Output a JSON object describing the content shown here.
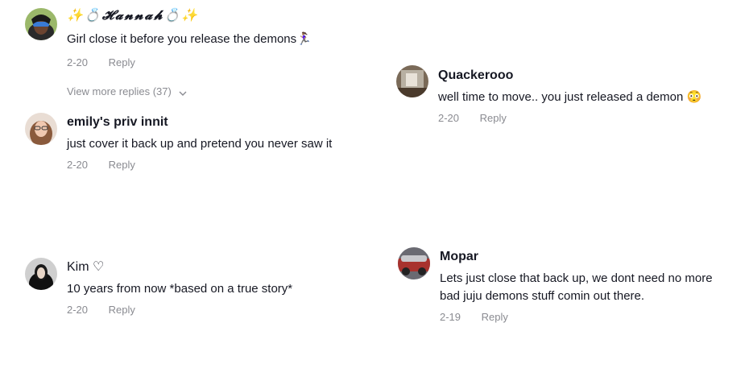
{
  "comments": [
    {
      "username": "✨💍𝓗𝓪𝓷𝓷𝓪𝓱💍✨",
      "text": "Girl close it before you release the demons🏃🏽‍♀️",
      "date": "2-20",
      "reply_label": "Reply",
      "avatar_icon": "user-avatar"
    },
    {
      "username": "emily's priv innit",
      "text": "just cover it back up and pretend you never saw it",
      "date": "2-20",
      "reply_label": "Reply",
      "avatar_icon": "user-avatar"
    },
    {
      "username": "Kim ♡",
      "text": "10 years from now *based on a true story*",
      "date": "2-20",
      "reply_label": "Reply",
      "avatar_icon": "user-avatar"
    },
    {
      "username": "Quackerooo",
      "text": "well time to move.. you just released a demon 😳",
      "date": "2-20",
      "reply_label": "Reply",
      "avatar_icon": "user-avatar"
    },
    {
      "username": "Mopar",
      "text_lines": [
        "Lets just close that back up, we dont need no more",
        "bad juju demons stuff comin out there."
      ],
      "date": "2-19",
      "reply_label": "Reply",
      "avatar_icon": "user-avatar"
    }
  ],
  "view_more": {
    "label": "View more replies (37)",
    "icon": "chevron-down-icon"
  },
  "colors": {
    "text": "#161823",
    "secondary": "#8a8b91",
    "background": "#ffffff"
  }
}
